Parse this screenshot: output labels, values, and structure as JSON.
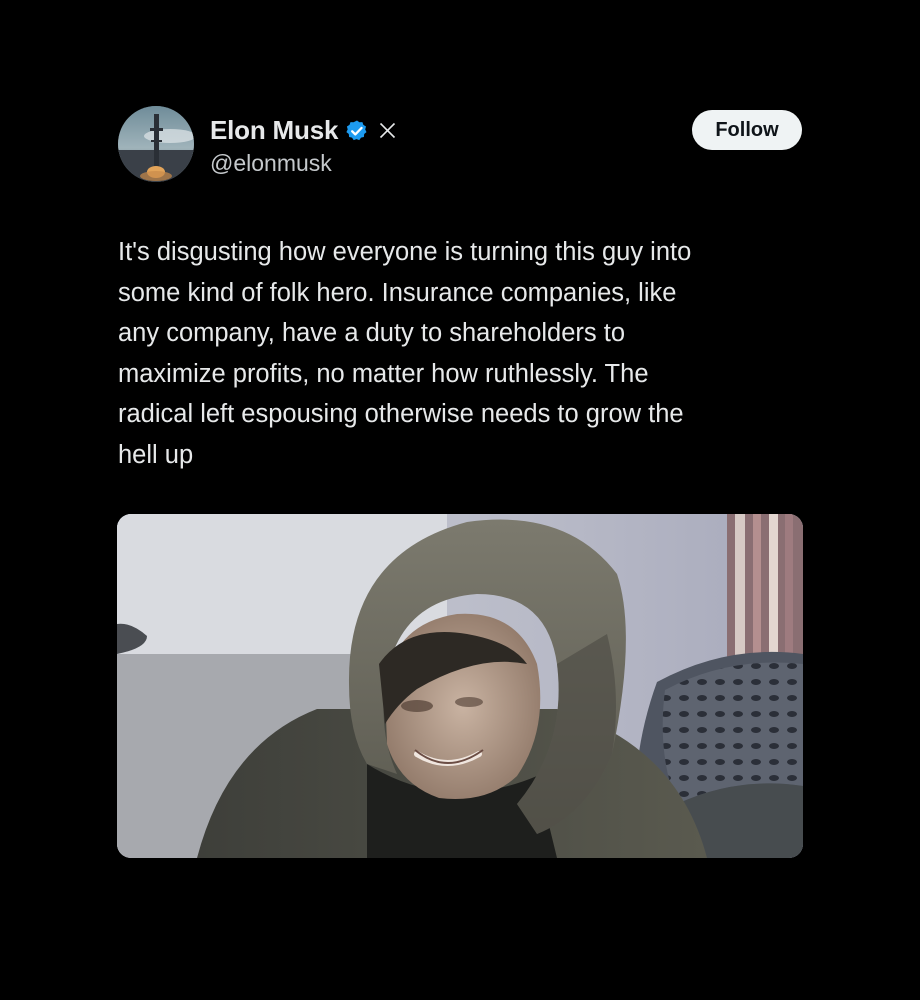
{
  "author": {
    "display_name": "Elon Musk",
    "handle": "@elonmusk",
    "avatar_icon": "profile-photo",
    "verified_icon": "verified-badge-icon",
    "affiliation_icon": "x-logo-icon",
    "verified_color": "#1d9bf0"
  },
  "follow_button": {
    "label": "Follow"
  },
  "tweet": {
    "text_lines": [
      "It's disgusting how everyone is turning this guy into",
      "some kind of folk hero. Insurance companies, like",
      "any company, have a duty to shareholders to",
      "maximize profits, no matter how ruthlessly. The",
      "radical left espousing otherwise needs to grow the",
      "hell up"
    ]
  },
  "media": {
    "kind": "photo"
  },
  "colors": {
    "background": "#000000",
    "text": "#e7e9ea",
    "secondary_text": "#c5c9cc",
    "button_bg": "#eff3f4",
    "button_text": "#0f1419"
  }
}
